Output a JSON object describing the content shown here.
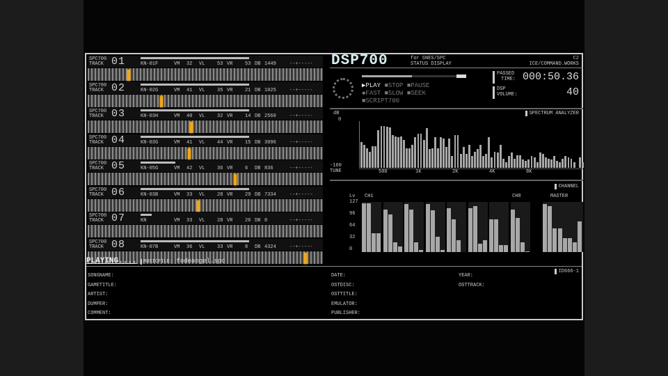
{
  "header": {
    "logo": "DSP700",
    "subtitle1": "for SNES/SPC",
    "subtitle2": "STATUS DISPLAY",
    "corner": "C2",
    "credit": "ICE/COMMAND.WORKS"
  },
  "channel_row_labels": {
    "tag": "SPC700",
    "sub": "TRACK",
    "kn": "KN",
    "vm": "VM",
    "vl": "VL",
    "vr": "VR",
    "db": "DB"
  },
  "channels": [
    {
      "num": "01",
      "kn": "-01F",
      "vm": "32",
      "vl": "53",
      "vr": "53",
      "db": "1449",
      "volume": 1.0,
      "key": 0.17
    },
    {
      "num": "02",
      "kn": "-02G",
      "vm": "41",
      "vl": "35",
      "vr": "21",
      "db": "1025",
      "volume": 1.0,
      "key": 0.31
    },
    {
      "num": "03",
      "kn": "-03H",
      "vm": "40",
      "vl": "32",
      "vr": "14",
      "db": "2560",
      "volume": 1.0,
      "key": 0.44
    },
    {
      "num": "04",
      "kn": "-03G",
      "vm": "41",
      "vl": "44",
      "vr": "15",
      "db": "3096",
      "volume": 1.0,
      "key": 0.43
    },
    {
      "num": "05",
      "kn": "-05G",
      "vm": "42",
      "vl": "36",
      "vr": "6",
      "db": "836",
      "volume": 0.32,
      "key": 0.63
    },
    {
      "num": "06",
      "kn": "-03B",
      "vm": "33",
      "vl": "28",
      "vr": "29",
      "db": "7334",
      "volume": 1.0,
      "key": 0.47
    },
    {
      "num": "07",
      "kn": "",
      "vm": "33",
      "vl": "28",
      "vr": "26",
      "db": "0",
      "volume": 0.1,
      "key": null
    },
    {
      "num": "08",
      "kn": "-07B",
      "vm": "36",
      "vl": "33",
      "vr": "8",
      "db": "4324",
      "volume": 1.0,
      "key": 0.93
    }
  ],
  "transport": {
    "play": "▶PLAY",
    "stop": "■STOP",
    "pause": "■PAUSE",
    "fast": "◆FAST",
    "slow": "■SLOW",
    "seek": "■SEEK",
    "script": "■SCRIPT700",
    "progress": 0.48
  },
  "time": {
    "label1": "PASSED",
    "label2": "TIME:",
    "value": "000:50.36"
  },
  "volume": {
    "label1": "DSP",
    "label2": "VOLUME:",
    "value": "40"
  },
  "status": {
    "state": "PLAYING....",
    "file_label": "MUSICFILE:",
    "file": "fodeangel.spc"
  },
  "tag_label": "ID666-1",
  "info_fields": {
    "col1": [
      "SONGNAME:",
      "GAMETITLE:",
      "ARTIST:",
      "DUMPER:",
      "COMMENT:"
    ],
    "col2": [
      "DATE:",
      "OSTDISC:",
      "OSTTITLE:",
      "EMULATOR:",
      "PUBLISHER:"
    ],
    "col3": [
      "YEAR:",
      "OSTTRACK:"
    ]
  },
  "chart_data": [
    {
      "type": "bar",
      "title": "SPECTRUM ANALYZER",
      "ylabel": "dB",
      "ylim": [
        -160,
        0
      ],
      "yticks": [
        "0",
        "-160"
      ],
      "xlabel": "TUNE",
      "xticks": [
        "500",
        "1K",
        "2K",
        "4K",
        "8K"
      ],
      "values": [
        -72,
        -80,
        -92,
        -104,
        -86,
        -86,
        -32,
        -16,
        -16,
        -20,
        -22,
        -48,
        -52,
        -56,
        -52,
        -64,
        -92,
        -92,
        -80,
        -56,
        -44,
        -44,
        -64,
        -24,
        -96,
        -92,
        -54,
        -92,
        -56,
        -60,
        -88,
        -60,
        -120,
        -48,
        -48,
        -112,
        -88,
        -112,
        -80,
        -120,
        -104,
        -96,
        -80,
        -120,
        -112,
        -56,
        -124,
        -104,
        -108,
        -80,
        -128,
        -140,
        -120,
        -108,
        -128,
        -116,
        -116,
        -132,
        -136,
        -132,
        -120,
        -124,
        -140,
        -108,
        -112,
        -124,
        -128,
        -132,
        -120,
        -136,
        -140,
        -128,
        -120,
        -124,
        -128,
        -140,
        -160,
        -124,
        -140
      ]
    },
    {
      "type": "bar",
      "title": "CHANNEL",
      "ylabel": "Lv",
      "ylim": [
        0,
        127
      ],
      "yticks": [
        "127",
        "96",
        "64",
        "32",
        "0"
      ],
      "first_label": "CH1",
      "last_label": "CH8",
      "master_label": "MASTER",
      "channels": [
        [
          124,
          124,
          48,
          48
        ],
        [
          108,
          95,
          25,
          14
        ],
        [
          121,
          108,
          25,
          6
        ],
        [
          121,
          105,
          38,
          6
        ],
        [
          111,
          83,
          30,
          0
        ],
        [
          111,
          116,
          21,
          30
        ],
        [
          83,
          83,
          18,
          18
        ],
        [
          108,
          86,
          25,
          2
        ]
      ],
      "master": [
        121,
        116,
        60,
        60,
        35,
        35,
        25,
        77
      ]
    }
  ],
  "colors": {
    "key": "#f0a818",
    "bars": "#a8a8a8",
    "border": "#c8ccd0"
  }
}
